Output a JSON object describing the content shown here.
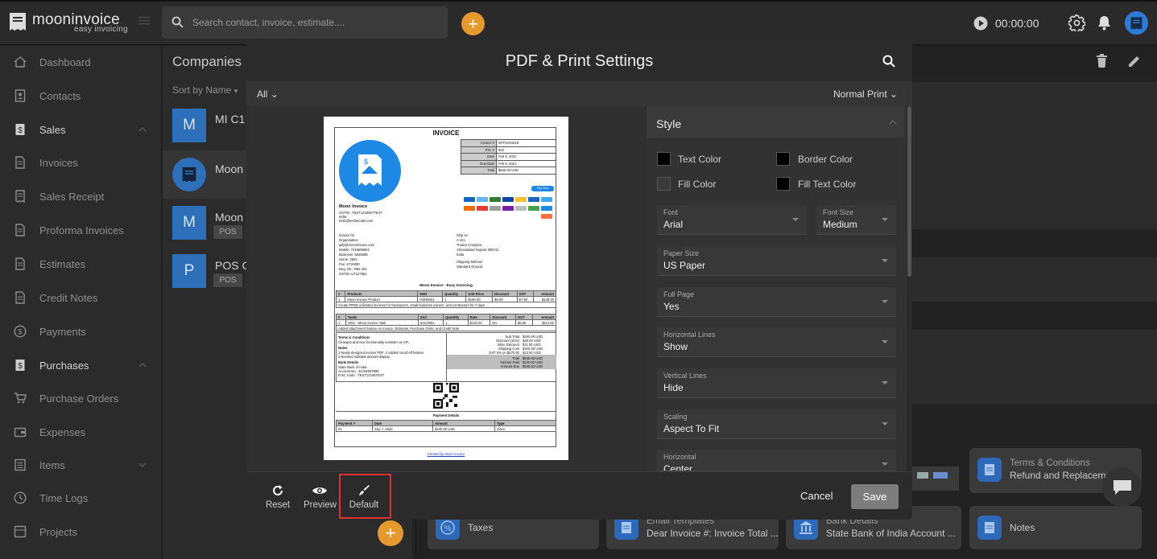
{
  "app": {
    "brand": "mooninvoice",
    "tagline": "easy invoicing"
  },
  "topbar": {
    "search_placeholder": "Search contact, invoice, estimate....",
    "add_label": "+",
    "timer": "00:00:00"
  },
  "sidebar": {
    "items": [
      {
        "label": "Dashboard",
        "icon": "home-icon"
      },
      {
        "label": "Contacts",
        "icon": "contact-book-icon"
      },
      {
        "label": "Sales",
        "icon": "dollar-doc-icon",
        "expanded": true
      },
      {
        "label": "Invoices",
        "icon": "document-icon"
      },
      {
        "label": "Sales Receipt",
        "icon": "receipt-icon"
      },
      {
        "label": "Proforma Invoices",
        "icon": "document-icon"
      },
      {
        "label": "Estimates",
        "icon": "document-icon"
      },
      {
        "label": "Credit Notes",
        "icon": "document-icon"
      },
      {
        "label": "Payments",
        "icon": "dollar-circle-icon"
      },
      {
        "label": "Purchases",
        "icon": "dollar-doc-icon",
        "expanded": true
      },
      {
        "label": "Purchase Orders",
        "icon": "cart-icon"
      },
      {
        "label": "Expenses",
        "icon": "wallet-icon"
      },
      {
        "label": "Items",
        "icon": "list-icon",
        "expanded": false
      },
      {
        "label": "Time Logs",
        "icon": "clock-icon"
      },
      {
        "label": "Projects",
        "icon": "folder-icon"
      }
    ]
  },
  "companies": {
    "title": "Companies",
    "sort": "Sort by Name",
    "rows": [
      {
        "initial": "M",
        "name": "MI C1",
        "badge": ""
      },
      {
        "initial": "",
        "name": "Moon I",
        "badge": ""
      },
      {
        "initial": "M",
        "name": "Moon I",
        "badge": "POS"
      },
      {
        "initial": "P",
        "name": "POS C",
        "badge": "POS"
      }
    ]
  },
  "background_cards": [
    {
      "l1": "",
      "l2": "Taxes"
    },
    {
      "l1": "Email Templates",
      "l2": "Dear Invoice #: Invoice Total ..."
    },
    {
      "l1": "Bank Details",
      "l2": "State Bank of India Account ..."
    },
    {
      "l1": "",
      "l2": "Notes"
    },
    {
      "l1": "Terms & Conditions",
      "l2": "Refund and Replaceme"
    }
  ],
  "modal": {
    "title": "PDF & Print Settings",
    "filter": "All",
    "print_mode": "Normal Print",
    "style": {
      "header": "Style",
      "colors": [
        {
          "label": "Text Color",
          "value": "#000000"
        },
        {
          "label": "Border Color",
          "value": "#000000"
        },
        {
          "label": "Fill Color",
          "value": "#3a3a3a"
        },
        {
          "label": "Fill Text Color",
          "value": "#000000"
        }
      ],
      "fields": [
        {
          "label": "Font",
          "value": "Arial"
        },
        {
          "label": "Font Size",
          "value": "Medium"
        },
        {
          "label": "Paper Size",
          "value": "US Paper"
        },
        {
          "label": "Full Page",
          "value": "Yes"
        },
        {
          "label": "Horizontal Lines",
          "value": "Show"
        },
        {
          "label": "Vertical Lines",
          "value": "Hide"
        },
        {
          "label": "Scaling",
          "value": "Aspect To Fit"
        },
        {
          "label": "Horizontal",
          "value": "Center"
        }
      ]
    },
    "footer": {
      "reset": "Reset",
      "preview": "Preview",
      "default": "Default",
      "cancel": "Cancel",
      "save": "Save"
    }
  },
  "invoice": {
    "heading": "INVOICE",
    "meta": [
      [
        "Invoice #",
        "MTPL001919"
      ],
      [
        "P.O. #",
        "552"
      ],
      [
        "Date",
        "Feb 9, 2021"
      ],
      [
        "Due Date",
        "Feb 9, 2021"
      ],
      [
        "Total",
        "$645.03 USD"
      ]
    ],
    "pay_now": "Pay Now",
    "company": "Moon Invoice",
    "company_lines": [
      "GSTIN : TEST1234567TEST",
      "India",
      "hello@technicabs.com"
    ],
    "invoice_for": [
      "Invoice for",
      "Organisation",
      "jully@mooninvoice.com",
      "Mobile: 7415589652",
      "Business: 5525699",
      "Home: 2501",
      "Fax: 4719300",
      "Reg. No.: R55 201",
      "GSTIN: UT147852"
    ],
    "ship_to": [
      "Ship to:",
      "A 101",
      "Trudeo Complex,",
      "Ahmedabad Gujarat 385741",
      "India",
      "Shipping Method:",
      "Standard Ground"
    ],
    "section_title": "Moon Invoice - Easy Invoicing",
    "products_head": [
      "#",
      "Products",
      "HSN",
      "Quantity",
      "Unit Price",
      "Discount",
      "GST",
      "Amount"
    ],
    "products_row": [
      "1.",
      "Moon Invoice Product",
      "HSN0001",
      "1",
      "$150.00",
      "$5.00",
      "$7.50",
      "$148.00"
    ],
    "products_note": "Create FREE unlimited invoices for freelancers, small business owners, and contractors for 7 days",
    "tasks_head": [
      "#",
      "Tasks",
      "SAC",
      "Quantity",
      "Rate",
      "Discount",
      "GST",
      "Amount"
    ],
    "tasks_row": [
      "1.",
      "1001 - Moon Invoice Task",
      "SAC0001",
      "1",
      "$120.00",
      "5%",
      "$5.00",
      "$114.00"
    ],
    "tasks_note": "Added attachment feature on Invoice, Estimate, Purchase Order, and Credit Note.",
    "terms": [
      "Terms & Conditions",
      "Changes and new functionality consider as CR.",
      "Notes",
      "1.Newly designed invoice PDF. 2.Added round off feature.",
      "3.Revised subtotal amount display.",
      "Bank Details",
      "State Bank of India",
      "Account No : 11234567890",
      "IFSC Code : TEST12345TEST"
    ],
    "totals": [
      [
        "Sub Total",
        "$250.00 USD"
      ],
      [
        "Discount (10%)",
        "$25.00 USD"
      ],
      [
        "Inline Discount",
        "$11.00 USD"
      ],
      [
        "Shipping Cost",
        "$100.00 USD"
      ],
      [
        "GST 5% on $270.00",
        "$13.50 USD"
      ]
    ],
    "totals2": [
      [
        "Total",
        "$645.03 USD"
      ],
      [
        "Amount Paid",
        "$100.00 USD"
      ],
      [
        "Amount Due",
        "$545.03 USD"
      ]
    ],
    "payment_title": "Payment Details",
    "payment_head": [
      "Payment #",
      "Date",
      "Amount",
      "Type"
    ],
    "payment_row": [
      "01",
      "Sep 7, 2020",
      "$100.00 USD",
      "Since"
    ],
    "footer_link": "Created by Moon Invoice"
  },
  "colors": {
    "accent_orange": "#e69a2e",
    "brand_blue": "#2d6fb9",
    "highlight_red": "#e03232"
  }
}
